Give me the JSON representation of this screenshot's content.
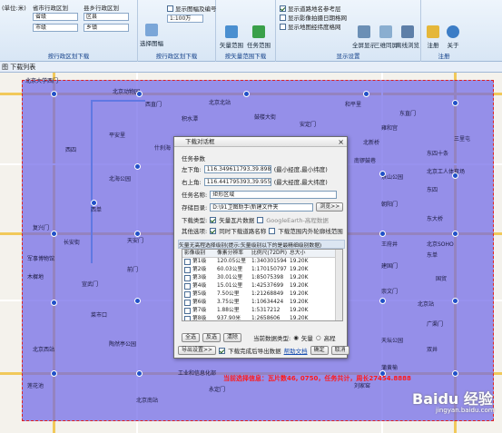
{
  "ribbon": {
    "row1": [
      "(单位:米)",
      "省市行政区划",
      "县乡行政区划",
      "显示图幅及编号",
      "显示道路地名参考层"
    ],
    "province": "省级",
    "city": "市级",
    "district": "区县",
    "town": "乡镇",
    "admin_group": "按行政区划下载",
    "select_sheet": "选择图幅",
    "scale": "1:100万",
    "sheet_group": "按行政区划下载",
    "vector_range": "矢量范围",
    "task_range": "任务范围",
    "task_group": "按矢量范围下载",
    "show_image_date": "显示影像拍摄日期格网",
    "show_map_tiles": "显示地图经纬度格网",
    "full_view": "全屏显示",
    "split_sync": "三维同屏",
    "offline_browse": "离线浏览",
    "display_group": "显示设置",
    "register": "注册",
    "about": "关于",
    "register_group": "注册"
  },
  "tab": "图 下载列表",
  "map_labels": [
    {
      "t": "北京大学西门"
    },
    {
      "t": "北京动物园"
    },
    {
      "t": "西直门"
    },
    {
      "t": "北京北站"
    },
    {
      "t": "和平里"
    },
    {
      "t": "东直门"
    },
    {
      "t": "积水潭"
    },
    {
      "t": "鼓楼大街"
    },
    {
      "t": "安定门"
    },
    {
      "t": "雍和宫"
    },
    {
      "t": "北新桥"
    },
    {
      "t": "东四十条"
    },
    {
      "t": "平安里"
    },
    {
      "t": "西四"
    },
    {
      "t": "什刹海"
    },
    {
      "t": "南锣鼓巷"
    },
    {
      "t": "北海公园"
    },
    {
      "t": "景山公园"
    },
    {
      "t": "东四"
    },
    {
      "t": "朝阳门"
    },
    {
      "t": "东大桥"
    },
    {
      "t": "西单"
    },
    {
      "t": "天安门"
    },
    {
      "t": "王府井"
    },
    {
      "t": "东单"
    },
    {
      "t": "建国门"
    },
    {
      "t": "国贸"
    },
    {
      "t": "复兴门"
    },
    {
      "t": "长安街"
    },
    {
      "t": "前门"
    },
    {
      "t": "崇文门"
    },
    {
      "t": "北京站"
    },
    {
      "t": "广渠门"
    },
    {
      "t": "宣武门"
    },
    {
      "t": "菜市口"
    },
    {
      "t": "天坛公园"
    },
    {
      "t": "陶然亭公园"
    },
    {
      "t": "永定门"
    },
    {
      "t": "蒲黄榆"
    },
    {
      "t": "刘家窑"
    },
    {
      "t": "北京南站"
    },
    {
      "t": "工业和信息化部"
    },
    {
      "t": "军事博物馆"
    },
    {
      "t": "木樨地"
    },
    {
      "t": "北京西站"
    },
    {
      "t": "莲花池"
    },
    {
      "t": "北京SOHO"
    },
    {
      "t": "双井"
    },
    {
      "t": "北京工人体育场"
    },
    {
      "t": "三里屯"
    }
  ],
  "dialog": {
    "title": "下载对话框",
    "section_task": "任务参数",
    "top_left_label": "左下角:",
    "top_left_value": "116.349611793,39.898496830",
    "top_left_hint": "(最小经度,最小纬度)",
    "bottom_right_label": "右上角:",
    "bottom_right_value": "116.441795393,39.955154787",
    "bottom_right_hint": "(最大经度,最大纬度)",
    "task_name_label": "任务名称:",
    "task_name_value": "矩形区域",
    "save_dir_label": "存储目录:",
    "save_dir_value": "D:\\91卫图助手\\新建文件夹",
    "browse": "浏览>>",
    "download_type_label": "下载类型:",
    "vector_data": "矢量瓦片数据",
    "google_earth": "GoogleEarth-高程数据",
    "other_label": "其他选项:",
    "sync_road": "同时下载道路名称",
    "download_range_only": "下载范围内外轮廓线范围",
    "level_bar": "矢量无高程选择级别(提示:矢量级别以下的是最精细级别数据)",
    "table_headers": [
      "影像级别",
      "像素分辨率",
      "比例尺(72DPI)",
      "总大小"
    ],
    "rows": [
      {
        "level": "第1级",
        "res": "120.05公里",
        "scale": "1:340301594",
        "size": "19.20K",
        "on": false
      },
      {
        "level": "第2级",
        "res": "60.03公里",
        "scale": "1:170150797",
        "size": "19.20K",
        "on": false
      },
      {
        "level": "第3级",
        "res": "30.01公里",
        "scale": "1:85075398",
        "size": "19.20K",
        "on": false
      },
      {
        "level": "第4级",
        "res": "15.01公里",
        "scale": "1:42537699",
        "size": "19.20K",
        "on": false
      },
      {
        "level": "第5级",
        "res": "7.50公里",
        "scale": "1:21268849",
        "size": "19.20K",
        "on": false
      },
      {
        "level": "第6级",
        "res": "3.75公里",
        "scale": "1:10634424",
        "size": "19.20K",
        "on": false
      },
      {
        "level": "第7级",
        "res": "1.88公里",
        "scale": "1:5317212",
        "size": "19.20K",
        "on": false
      },
      {
        "level": "第8级",
        "res": "937.90米",
        "scale": "1:2658606",
        "size": "19.20K",
        "on": false
      }
    ],
    "select_all": "全选",
    "invert": "反选",
    "clear": "清除",
    "current_type_label": "当前数据类型:",
    "type_vector": "矢量",
    "type_elevation": "高程",
    "export": "导出设置>>",
    "download_after": "下载完成后导出数据",
    "help": "帮助文档",
    "ok": "确定",
    "cancel": "取消"
  },
  "status": "当前选择信息：瓦片数46, 0750，任务共计，周长27454.8888",
  "watermark": "Baidu 经验",
  "watermark_sub": "jingyan.baidu.com"
}
